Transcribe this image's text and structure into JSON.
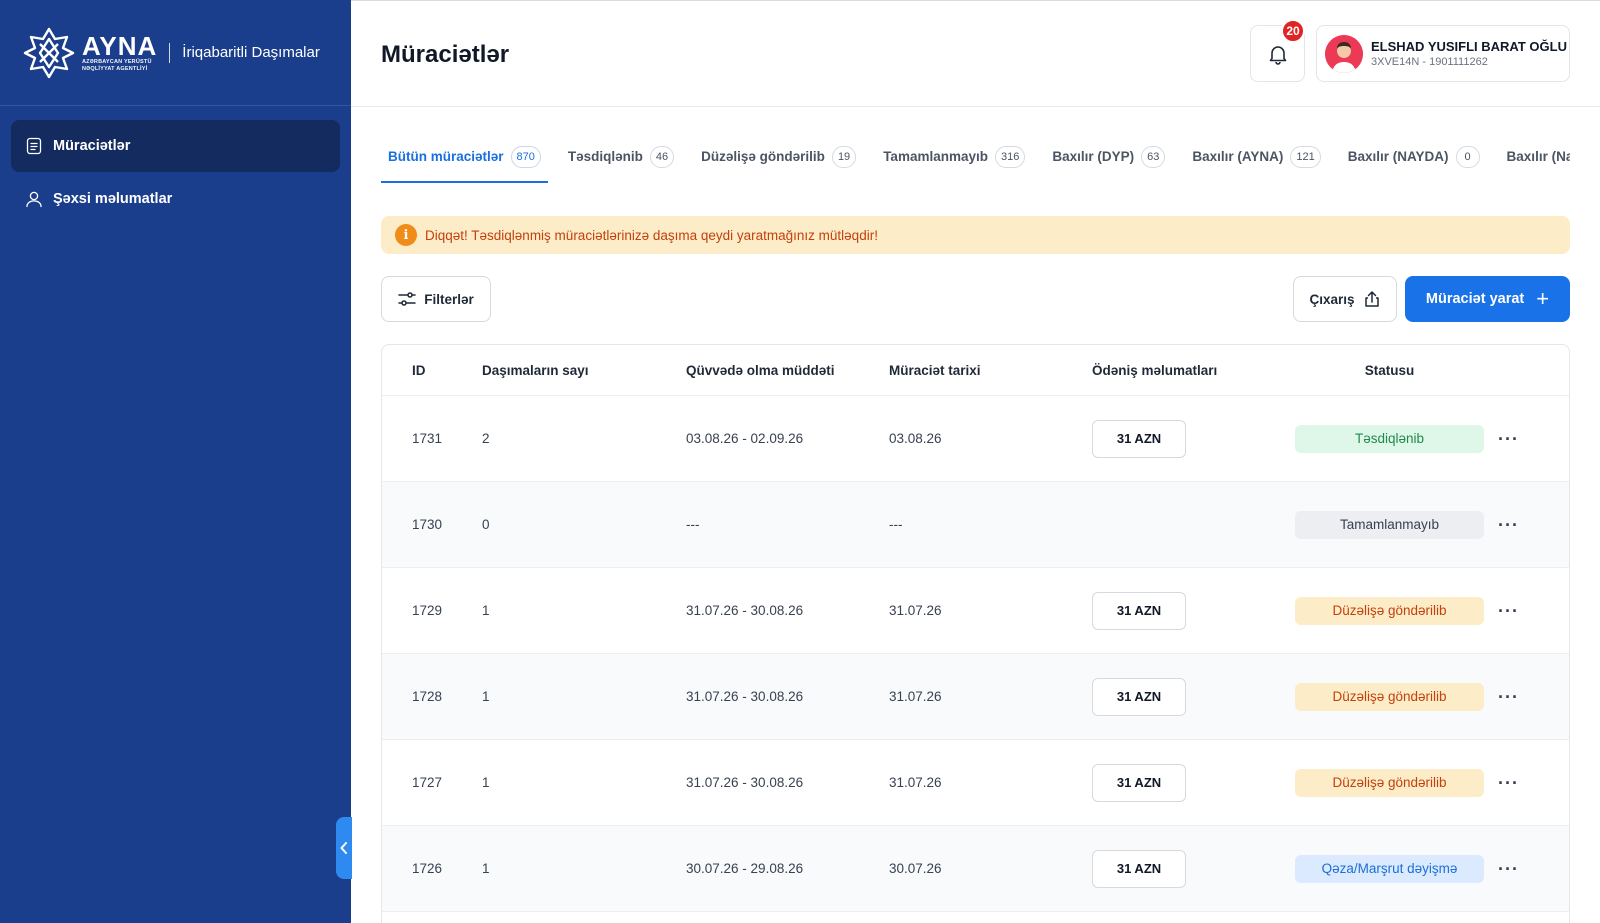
{
  "brand": {
    "name": "AYNA",
    "subtitle_line1": "AZƏRBAYCAN YERÜSTÜ",
    "subtitle_line2": "NƏQLİYYAT AGENTLİYİ",
    "app_name": "İriqabaritli Daşımalar"
  },
  "sidebar": {
    "items": [
      {
        "label": "Müraciətlər",
        "icon": "document-icon",
        "active": true
      },
      {
        "label": "Şəxsi məlumatlar",
        "icon": "user-icon",
        "active": false
      }
    ],
    "collapse_icon": "chevron-left-icon"
  },
  "header": {
    "title": "Müraciətlər",
    "notifications_count": "20",
    "user_name": "ELSHAD YUSIFLI BARAT OĞLU",
    "user_id": "3XVE14N - 1901111262"
  },
  "tabs": [
    {
      "label": "Bütün müraciətlər",
      "count": "870",
      "active": true
    },
    {
      "label": "Təsdiqlənib",
      "count": "46"
    },
    {
      "label": "Düzəlişə göndərilib",
      "count": "19"
    },
    {
      "label": "Tamamlanmayıb",
      "count": "316"
    },
    {
      "label": "Baxılır (DYP)",
      "count": "63"
    },
    {
      "label": "Baxılır (AYNA)",
      "count": "121"
    },
    {
      "label": "Baxılır (NAYDA)",
      "count": "0"
    },
    {
      "label": "Baxılır (Naxçıv",
      "count": ""
    }
  ],
  "alert": {
    "text": "Diqqət! Təsdiqlənmiş müraciətlərinizə daşıma qeydi yaratmağınız mütləqdir!"
  },
  "toolbar": {
    "filters_label": "Filterlər",
    "export_label": "Çıxarış",
    "create_label": "Müraciət yarat"
  },
  "table": {
    "headers": [
      "ID",
      "Daşımaların sayı",
      "Qüvvədə olma müddəti",
      "Müraciət tarixi",
      "Ödəniş məlumatları",
      "Statusu"
    ],
    "rows": [
      {
        "id": "1731",
        "count": "2",
        "validity": "03.08.26 - 02.09.26",
        "date": "03.08.26",
        "payment": "31 AZN",
        "status": "Təsdiqlənib",
        "status_type": "green"
      },
      {
        "id": "1730",
        "count": "0",
        "validity": "---",
        "date": "---",
        "payment": "",
        "status": "Tamamlanmayıb",
        "status_type": "gray"
      },
      {
        "id": "1729",
        "count": "1",
        "validity": "31.07.26 - 30.08.26",
        "date": "31.07.26",
        "payment": "31 AZN",
        "status": "Düzəlişə göndərilib",
        "status_type": "yellow"
      },
      {
        "id": "1728",
        "count": "1",
        "validity": "31.07.26 - 30.08.26",
        "date": "31.07.26",
        "payment": "31 AZN",
        "status": "Düzəlişə göndərilib",
        "status_type": "yellow"
      },
      {
        "id": "1727",
        "count": "1",
        "validity": "31.07.26 - 30.08.26",
        "date": "31.07.26",
        "payment": "31 AZN",
        "status": "Düzəlişə göndərilib",
        "status_type": "yellow"
      },
      {
        "id": "1726",
        "count": "1",
        "validity": "30.07.26 - 29.08.26",
        "date": "30.07.26",
        "payment": "31 AZN",
        "status": "Qəza/Marşrut dəyişmə",
        "status_type": "blue"
      }
    ],
    "more_label": "···"
  },
  "colors": {
    "sidebar": "#1b3e8c",
    "sidebar_active": "#142b5f",
    "primary": "#1a72e8",
    "alert_bg": "#fdecc8",
    "alert_text": "#c2410c"
  }
}
